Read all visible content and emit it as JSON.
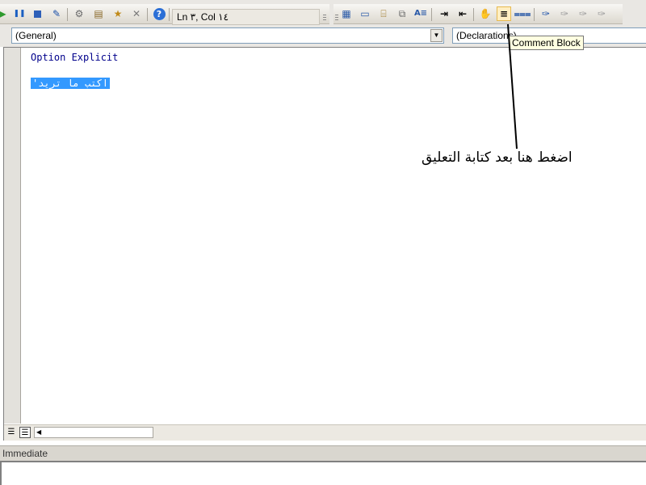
{
  "toolbar": {
    "cursor_position": "Ln ۳, Col ۱٤",
    "icons": [
      "run-icon",
      "pause-icon",
      "stop-icon",
      "design-mode-icon",
      "project-explorer-icon",
      "properties-icon",
      "object-browser-icon",
      "toolbox-icon",
      "help-icon",
      "list-properties-icon",
      "list-constants-icon",
      "quick-info-icon",
      "parameter-info-icon",
      "complete-word-icon",
      "indent-icon",
      "outdent-icon",
      "toggle-breakpoint-icon",
      "comment-block-icon",
      "uncomment-block-icon",
      "toggle-bookmark-icon",
      "next-bookmark-icon",
      "previous-bookmark-icon",
      "clear-bookmarks-icon"
    ]
  },
  "combos": {
    "object": "(General)",
    "procedure": "(Declarations)"
  },
  "code": {
    "line1_keyword": "Option Explicit",
    "line3_comment": "'اكتب ما تريد"
  },
  "tooltip": "Comment Block",
  "annotation": "اضغط هنا بعد كتابة التعليق",
  "immediate": {
    "title": "Immediate"
  },
  "colors": {
    "keyword": "#00008b",
    "selection": "#3399ff",
    "tooltip_bg": "#ffffe1"
  }
}
